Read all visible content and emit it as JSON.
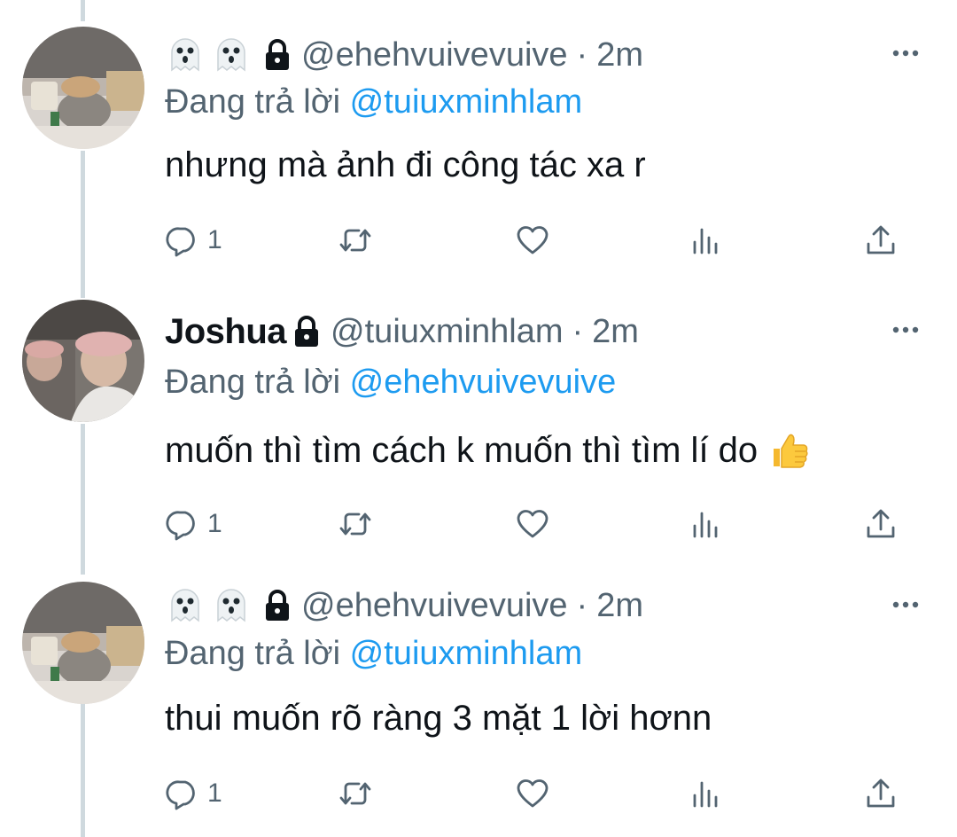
{
  "tweets": [
    {
      "display_name": "",
      "name_emojis": [
        "ghost-emoji",
        "ghost-emoji"
      ],
      "locked": true,
      "handle": "@ehehvuivevuive",
      "separator": "·",
      "time": "2m",
      "reply_prefix": "Đang trả lời",
      "reply_to": "@tuiuxminhlam",
      "text": "nhưng mà ảnh đi công tác xa r",
      "text_emoji": null,
      "reply_count": "1"
    },
    {
      "display_name": "Joshua",
      "name_emojis": [],
      "locked": true,
      "handle": "@tuiuxminhlam",
      "separator": "·",
      "time": "2m",
      "reply_prefix": "Đang trả lời",
      "reply_to": "@ehehvuivevuive",
      "text": "muốn thì tìm cách k muốn thì tìm lí do",
      "text_emoji": "thumbs-up-emoji",
      "reply_count": "1"
    },
    {
      "display_name": "",
      "name_emojis": [
        "ghost-emoji",
        "ghost-emoji"
      ],
      "locked": true,
      "handle": "@ehehvuivevuive",
      "separator": "·",
      "time": "2m",
      "reply_prefix": "Đang trả lời",
      "reply_to": "@tuiuxminhlam",
      "text": "thui muốn rõ ràng 3 mặt 1 lời hơnn",
      "text_emoji": null,
      "reply_count": "1"
    }
  ],
  "icons": {
    "more": "more-horizontal-icon",
    "reply": "reply-icon",
    "retweet": "retweet-icon",
    "like": "heart-icon",
    "views": "views-icon",
    "share": "share-icon",
    "lock": "lock-icon"
  },
  "colors": {
    "text": "#0f1419",
    "secondary": "#536471",
    "link": "#1d9bf0",
    "thread_line": "#cfd9de"
  }
}
